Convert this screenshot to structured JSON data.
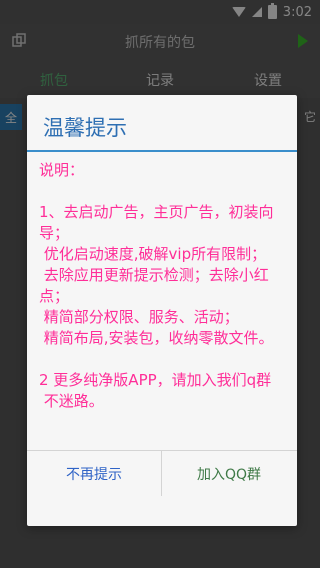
{
  "status_bar": {
    "time": "3:02"
  },
  "toolbar": {
    "title": "抓所有的包"
  },
  "tabs": [
    {
      "label": "抓包",
      "active": true
    },
    {
      "label": "记录",
      "active": false
    },
    {
      "label": "设置",
      "active": false
    }
  ],
  "content": {
    "left_chip": "全",
    "right_text": "它"
  },
  "dialog": {
    "title": "温馨提示",
    "message": "说明：\n\n1、去启动广告，主页广告，初装向导；\n 优化启动速度,破解vip所有限制；\n 去除应用更新提示检测；去除小红点；\n 精简部分权限、服务、活动；\n 精简布局,安装包，收纳零散文件。\n\n2 更多纯净版APP，请加入我们q群\n 不迷路。",
    "buttons": {
      "dismiss": "不再提示",
      "join": "加入QQ群"
    }
  },
  "colors": {
    "accent": "#2e6fb3",
    "message_text": "#ff2e98",
    "active_tab": "#5dbb79",
    "play_button": "#3cbf2d"
  }
}
